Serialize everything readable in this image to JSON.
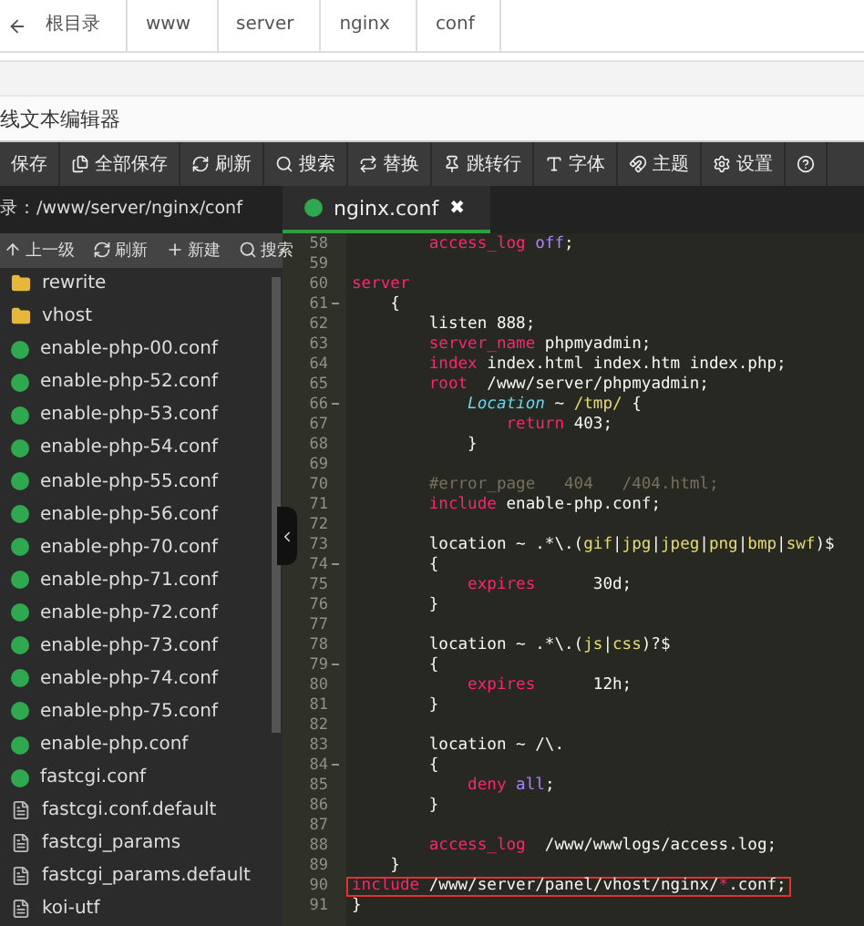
{
  "breadcrumb": [
    "根目录",
    "www",
    "server",
    "nginx",
    "conf"
  ],
  "editor_title": "线文本编辑器",
  "toolbar": [
    {
      "label": "保存",
      "kind": "none"
    },
    {
      "label": "全部保存",
      "kind": "save-all"
    },
    {
      "label": "刷新",
      "kind": "refresh"
    },
    {
      "label": "搜索",
      "kind": "search"
    },
    {
      "label": "替换",
      "kind": "replace"
    },
    {
      "label": "跳转行",
      "kind": "pin"
    },
    {
      "label": "字体",
      "kind": "font"
    },
    {
      "label": "主题",
      "kind": "theme"
    },
    {
      "label": "设置",
      "kind": "settings"
    },
    {
      "kind": "help"
    }
  ],
  "path": "录：/www/server/nginx/conf",
  "tabs": [
    {
      "label": "nginx.conf",
      "close": "✖",
      "selected": true
    }
  ],
  "sidebar_actions": [
    {
      "label": "上一级",
      "kind": "up"
    },
    {
      "label": "刷新",
      "kind": "refresh"
    },
    {
      "label": "新建",
      "kind": "plus"
    },
    {
      "label": "搜索",
      "kind": "search"
    }
  ],
  "files": [
    {
      "name": "rewrite",
      "kind": "folder"
    },
    {
      "name": "vhost",
      "kind": "folder"
    },
    {
      "name": "enable-php-00.conf",
      "kind": "nginx"
    },
    {
      "name": "enable-php-52.conf",
      "kind": "nginx"
    },
    {
      "name": "enable-php-53.conf",
      "kind": "nginx"
    },
    {
      "name": "enable-php-54.conf",
      "kind": "nginx"
    },
    {
      "name": "enable-php-55.conf",
      "kind": "nginx"
    },
    {
      "name": "enable-php-56.conf",
      "kind": "nginx"
    },
    {
      "name": "enable-php-70.conf",
      "kind": "nginx"
    },
    {
      "name": "enable-php-71.conf",
      "kind": "nginx"
    },
    {
      "name": "enable-php-72.conf",
      "kind": "nginx"
    },
    {
      "name": "enable-php-73.conf",
      "kind": "nginx"
    },
    {
      "name": "enable-php-74.conf",
      "kind": "nginx"
    },
    {
      "name": "enable-php-75.conf",
      "kind": "nginx"
    },
    {
      "name": "enable-php.conf",
      "kind": "nginx"
    },
    {
      "name": "fastcgi.conf",
      "kind": "nginx"
    },
    {
      "name": "fastcgi.conf.default",
      "kind": "file"
    },
    {
      "name": "fastcgi_params",
      "kind": "file"
    },
    {
      "name": "fastcgi_params.default",
      "kind": "file"
    },
    {
      "name": "koi-utf",
      "kind": "file"
    }
  ],
  "code": [
    {
      "n": "58",
      "fold": false,
      "highlighted": false,
      "tokens": [
        {
          "text": "        access_log",
          "kind": "keyword"
        },
        {
          "text": " off",
          "kind": "constant"
        },
        {
          "text": ";",
          "kind": "plain"
        }
      ]
    },
    {
      "n": "59",
      "fold": false,
      "highlighted": false
    },
    {
      "n": "60",
      "fold": false,
      "highlighted": false,
      "tokens": [
        {
          "text": "server",
          "kind": "keyword"
        }
      ]
    },
    {
      "n": "61",
      "fold": true,
      "highlighted": false,
      "tokens": [
        {
          "text": "    {",
          "kind": "plain"
        }
      ]
    },
    {
      "n": "62",
      "fold": false,
      "highlighted": false,
      "tokens": [
        {
          "text": "        listen 888;",
          "kind": "plain"
        }
      ]
    },
    {
      "n": "63",
      "fold": false,
      "highlighted": false,
      "tokens": [
        {
          "text": "        server_name",
          "kind": "keyword"
        },
        {
          "text": " phpmyadmin;",
          "kind": "plain"
        }
      ]
    },
    {
      "n": "64",
      "fold": false,
      "highlighted": false,
      "tokens": [
        {
          "text": "        index",
          "kind": "keyword"
        },
        {
          "text": " index.html index.htm index.php;",
          "kind": "plain"
        }
      ]
    },
    {
      "n": "65",
      "fold": false,
      "highlighted": false,
      "tokens": [
        {
          "text": "        root",
          "kind": "keyword"
        },
        {
          "text": "  /www/server/phpmyadmin;",
          "kind": "plain"
        }
      ]
    },
    {
      "n": "66",
      "fold": true,
      "highlighted": false,
      "tokens": [
        {
          "text": "            Location",
          "kind": "function"
        },
        {
          "text": " ~ ",
          "kind": "plain"
        },
        {
          "text": "/tmp/",
          "kind": "string"
        },
        {
          "text": " {",
          "kind": "plain"
        }
      ]
    },
    {
      "n": "67",
      "fold": false,
      "highlighted": false,
      "tokens": [
        {
          "text": "                return",
          "kind": "keyword"
        },
        {
          "text": " 403;",
          "kind": "plain"
        }
      ]
    },
    {
      "n": "68",
      "fold": false,
      "highlighted": false,
      "tokens": [
        {
          "text": "            }",
          "kind": "plain"
        }
      ]
    },
    {
      "n": "69",
      "fold": false,
      "highlighted": false
    },
    {
      "n": "70",
      "fold": false,
      "highlighted": false,
      "tokens": [
        {
          "text": "        #error_page   404   /404.html;",
          "kind": "comment"
        }
      ]
    },
    {
      "n": "71",
      "fold": false,
      "highlighted": false,
      "tokens": [
        {
          "text": "        include",
          "kind": "keyword"
        },
        {
          "text": " enable-php.conf;",
          "kind": "plain"
        }
      ]
    },
    {
      "n": "72",
      "fold": false,
      "highlighted": false
    },
    {
      "n": "73",
      "fold": false,
      "highlighted": false,
      "tokens": [
        {
          "text": "        location ~ .*\\.(",
          "kind": "plain"
        },
        {
          "text": "gif",
          "kind": "string"
        },
        {
          "text": "|",
          "kind": "plain"
        },
        {
          "text": "jpg",
          "kind": "string"
        },
        {
          "text": "|",
          "kind": "plain"
        },
        {
          "text": "jpeg",
          "kind": "string"
        },
        {
          "text": "|",
          "kind": "plain"
        },
        {
          "text": "png",
          "kind": "string"
        },
        {
          "text": "|",
          "kind": "plain"
        },
        {
          "text": "bmp",
          "kind": "string"
        },
        {
          "text": "|",
          "kind": "plain"
        },
        {
          "text": "swf",
          "kind": "string"
        },
        {
          "text": ")$",
          "kind": "plain"
        }
      ]
    },
    {
      "n": "74",
      "fold": true,
      "highlighted": false,
      "tokens": [
        {
          "text": "        {",
          "kind": "plain"
        }
      ]
    },
    {
      "n": "75",
      "fold": false,
      "highlighted": false,
      "tokens": [
        {
          "text": "            expires",
          "kind": "keyword"
        },
        {
          "text": "      30d;",
          "kind": "plain"
        }
      ]
    },
    {
      "n": "76",
      "fold": false,
      "highlighted": false,
      "tokens": [
        {
          "text": "        }",
          "kind": "plain"
        }
      ]
    },
    {
      "n": "77",
      "fold": false,
      "highlighted": false
    },
    {
      "n": "78",
      "fold": false,
      "highlighted": false,
      "tokens": [
        {
          "text": "        location ~ .*\\.(",
          "kind": "plain"
        },
        {
          "text": "js",
          "kind": "string"
        },
        {
          "text": "|",
          "kind": "plain"
        },
        {
          "text": "css",
          "kind": "string"
        },
        {
          "text": ")?$",
          "kind": "plain"
        }
      ]
    },
    {
      "n": "79",
      "fold": true,
      "highlighted": false,
      "tokens": [
        {
          "text": "        {",
          "kind": "plain"
        }
      ]
    },
    {
      "n": "80",
      "fold": false,
      "highlighted": false,
      "tokens": [
        {
          "text": "            expires",
          "kind": "keyword"
        },
        {
          "text": "      12h;",
          "kind": "plain"
        }
      ]
    },
    {
      "n": "81",
      "fold": false,
      "highlighted": false,
      "tokens": [
        {
          "text": "        }",
          "kind": "plain"
        }
      ]
    },
    {
      "n": "82",
      "fold": false,
      "highlighted": false
    },
    {
      "n": "83",
      "fold": false,
      "highlighted": false,
      "tokens": [
        {
          "text": "        location ~ /\\.",
          "kind": "plain"
        }
      ]
    },
    {
      "n": "84",
      "fold": true,
      "highlighted": false,
      "tokens": [
        {
          "text": "        {",
          "kind": "plain"
        }
      ]
    },
    {
      "n": "85",
      "fold": false,
      "highlighted": false,
      "tokens": [
        {
          "text": "            deny",
          "kind": "keyword"
        },
        {
          "text": " all",
          "kind": "constant"
        },
        {
          "text": ";",
          "kind": "plain"
        }
      ]
    },
    {
      "n": "86",
      "fold": false,
      "highlighted": false,
      "tokens": [
        {
          "text": "        }",
          "kind": "plain"
        }
      ]
    },
    {
      "n": "87",
      "fold": false,
      "highlighted": false
    },
    {
      "n": "88",
      "fold": false,
      "highlighted": false,
      "tokens": [
        {
          "text": "        access_log",
          "kind": "keyword"
        },
        {
          "text": "  /www/wwwlogs/access.log;",
          "kind": "plain"
        }
      ]
    },
    {
      "n": "89",
      "fold": false,
      "highlighted": false,
      "tokens": [
        {
          "text": "    }",
          "kind": "plain"
        }
      ]
    },
    {
      "n": "90",
      "fold": false,
      "highlighted": true,
      "tokens": [
        {
          "text": "include",
          "kind": "keyword"
        },
        {
          "text": " /www/server/panel/vhost/nginx/",
          "kind": "plain"
        },
        {
          "text": "*",
          "kind": "keyword"
        },
        {
          "text": ".conf;",
          "kind": "plain"
        }
      ]
    },
    {
      "n": "91",
      "fold": false,
      "highlighted": false,
      "tokens": [
        {
          "text": "}",
          "kind": "plain"
        }
      ]
    }
  ]
}
